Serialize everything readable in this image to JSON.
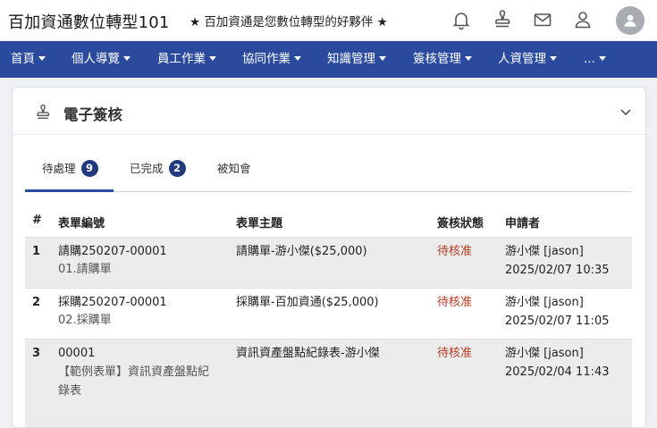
{
  "header": {
    "app_title": "百加資通數位轉型101",
    "slogan": "★ 百加資通是您數位轉型的好夥伴 ★"
  },
  "icons": {
    "notifications": "bell-icon",
    "approval": "stamp-icon",
    "mail": "mail-icon",
    "user": "user-icon",
    "avatar": "user-avatar-icon"
  },
  "nav": {
    "items": [
      {
        "label": "首頁"
      },
      {
        "label": "個人導覽"
      },
      {
        "label": "員工作業"
      },
      {
        "label": "協同作業"
      },
      {
        "label": "知識管理"
      },
      {
        "label": "簽核管理"
      },
      {
        "label": "人資管理"
      },
      {
        "label": "..."
      }
    ]
  },
  "card": {
    "title": "電子簽核"
  },
  "tabs": [
    {
      "label": "待處理",
      "count": "9"
    },
    {
      "label": "已完成",
      "count": "2"
    },
    {
      "label": "被知會"
    }
  ],
  "table": {
    "headers": [
      "#",
      "表單編號",
      "表單主題",
      "簽核狀態",
      "申請者"
    ],
    "rows": [
      {
        "index": "1",
        "form_no": "請購250207-00001",
        "form_type": "01.請購單",
        "subject": "請購單-游小傑($25,000)",
        "status": "待核准",
        "applicant": "游小傑 [jason]",
        "date": "2025/02/07 10:35"
      },
      {
        "index": "2",
        "form_no": "採購250207-00001",
        "form_type": "02.採購單",
        "subject": "採購單-百加資通($25,000)",
        "status": "待核准",
        "applicant": "游小傑 [jason]",
        "date": "2025/02/07 11:05"
      },
      {
        "index": "3",
        "form_no": "00001",
        "form_type_line1": "【範例表單】資訊資產盤點紀",
        "form_type_line2": "錄表",
        "subject": "資訊資產盤點紀錄表-游小傑",
        "status": "待核准",
        "applicant": "游小傑 [jason]",
        "date": "2025/02/04 11:43"
      }
    ]
  },
  "colors": {
    "nav_bg": "#2a4a9e",
    "badge_bg": "#213a7e",
    "status_pending": "#b63a1f",
    "row_shade": "#ececec"
  }
}
